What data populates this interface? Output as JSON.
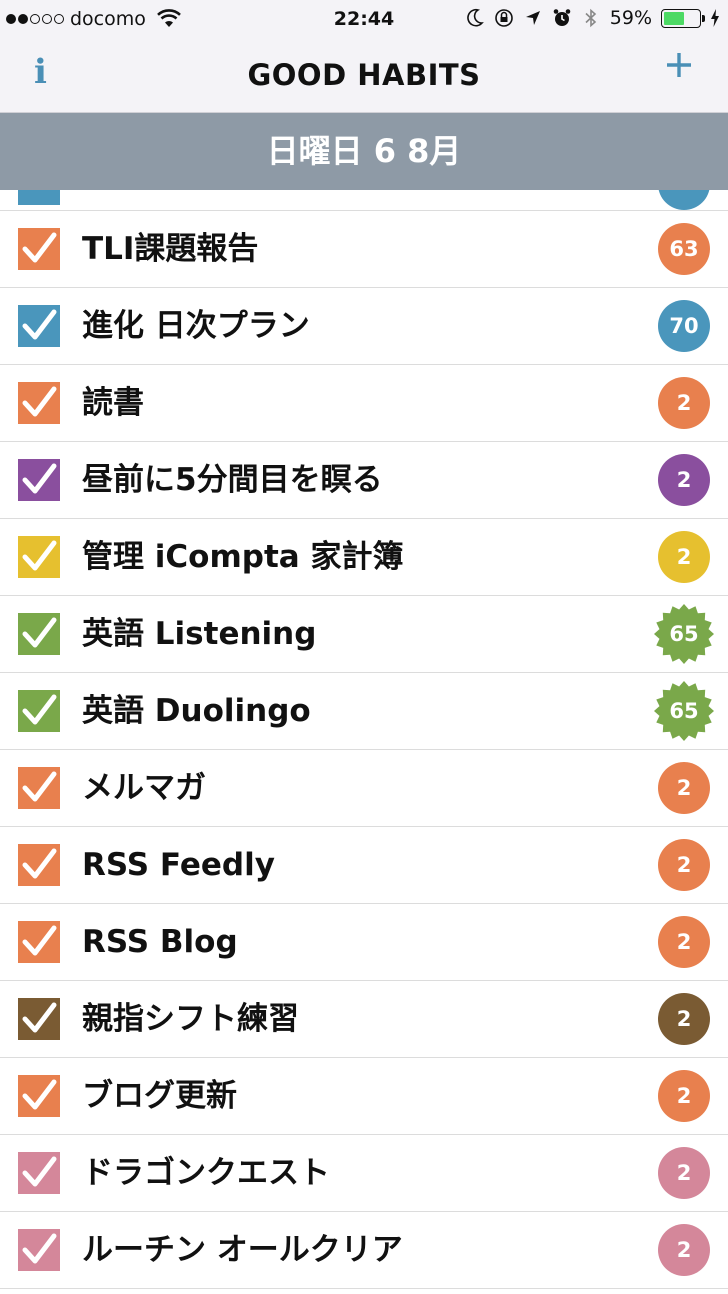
{
  "status_bar": {
    "carrier": "docomo",
    "time": "22:44",
    "battery_percent": "59%",
    "battery_level": 0.59,
    "signal_bars": 2,
    "signal_total": 5
  },
  "nav": {
    "title": "GOOD HABITS",
    "info_label": "i",
    "add_icon": "plus-icon"
  },
  "date_banner": "日曜日 6 8月",
  "colors": {
    "blue": "#4a96bc",
    "orange": "#e8804e",
    "purple": "#8a4f9e",
    "yellow": "#e6c02f",
    "green": "#7aa84a",
    "brown": "#7a5b33",
    "pink": "#d4879a"
  },
  "habits": [
    {
      "label": "TLI課題報告",
      "count": "63",
      "color": "orange",
      "badge_style": "circle"
    },
    {
      "label": "進化 日次プラン",
      "count": "70",
      "color": "blue",
      "badge_style": "circle"
    },
    {
      "label": "読書",
      "count": "2",
      "color": "orange",
      "badge_style": "circle"
    },
    {
      "label": "昼前に5分間目を瞑る",
      "count": "2",
      "color": "purple",
      "badge_style": "circle"
    },
    {
      "label": "管理 iCompta 家計簿",
      "count": "2",
      "color": "yellow",
      "badge_style": "circle"
    },
    {
      "label": "英語 Listening",
      "count": "65",
      "color": "green",
      "badge_style": "burst"
    },
    {
      "label": "英語 Duolingo",
      "count": "65",
      "color": "green",
      "badge_style": "burst"
    },
    {
      "label": "メルマガ",
      "count": "2",
      "color": "orange",
      "badge_style": "circle"
    },
    {
      "label": "RSS Feedly",
      "count": "2",
      "color": "orange",
      "badge_style": "circle"
    },
    {
      "label": "RSS Blog",
      "count": "2",
      "color": "orange",
      "badge_style": "circle"
    },
    {
      "label": "親指シフト練習",
      "count": "2",
      "color": "brown",
      "badge_style": "circle"
    },
    {
      "label": "ブログ更新",
      "count": "2",
      "color": "orange",
      "badge_style": "circle"
    },
    {
      "label": "ドラゴンクエスト",
      "count": "2",
      "color": "pink",
      "badge_style": "circle"
    },
    {
      "label": "ルーチン オールクリア",
      "count": "2",
      "color": "pink",
      "badge_style": "circle"
    }
  ]
}
